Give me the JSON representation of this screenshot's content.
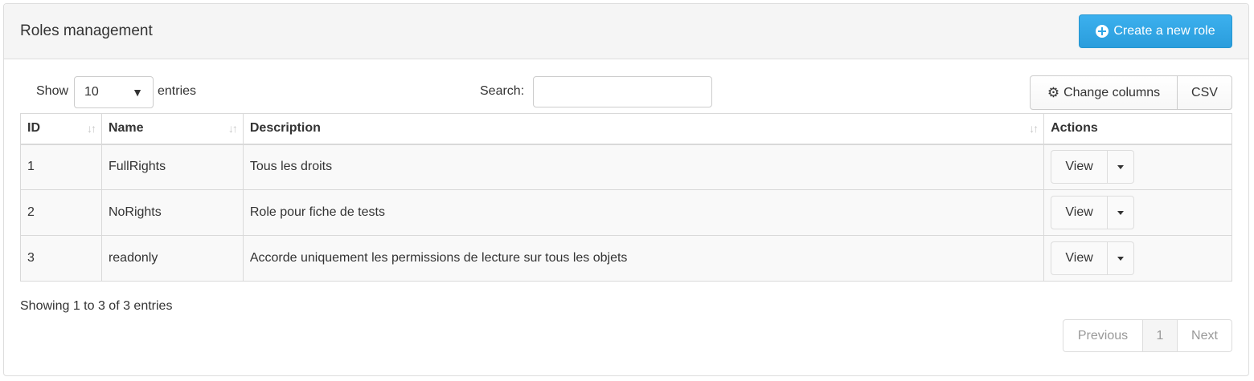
{
  "header": {
    "title": "Roles management",
    "create_button": "Create a new role"
  },
  "controls": {
    "show_label": "Show",
    "entries_value": "10",
    "entries_label": "entries",
    "search_label": "Search:",
    "search_value": "",
    "change_columns": "Change columns",
    "csv": "CSV"
  },
  "table": {
    "columns": [
      "ID",
      "Name",
      "Description",
      "Actions"
    ],
    "rows": [
      {
        "id": "1",
        "name": "FullRights",
        "description": "Tous les droits",
        "action": "View"
      },
      {
        "id": "2",
        "name": "NoRights",
        "description": "Role pour fiche de tests",
        "action": "View"
      },
      {
        "id": "3",
        "name": "readonly",
        "description": "Accorde uniquement les permissions de lecture sur tous les objets",
        "action": "View"
      }
    ]
  },
  "footer": {
    "info": "Showing 1 to 3 of 3 entries",
    "previous": "Previous",
    "page": "1",
    "next": "Next"
  },
  "colors": {
    "primary": "#2ea6e6",
    "heading_bg": "#f5f5f5",
    "row_bg": "#f9f9f9"
  }
}
